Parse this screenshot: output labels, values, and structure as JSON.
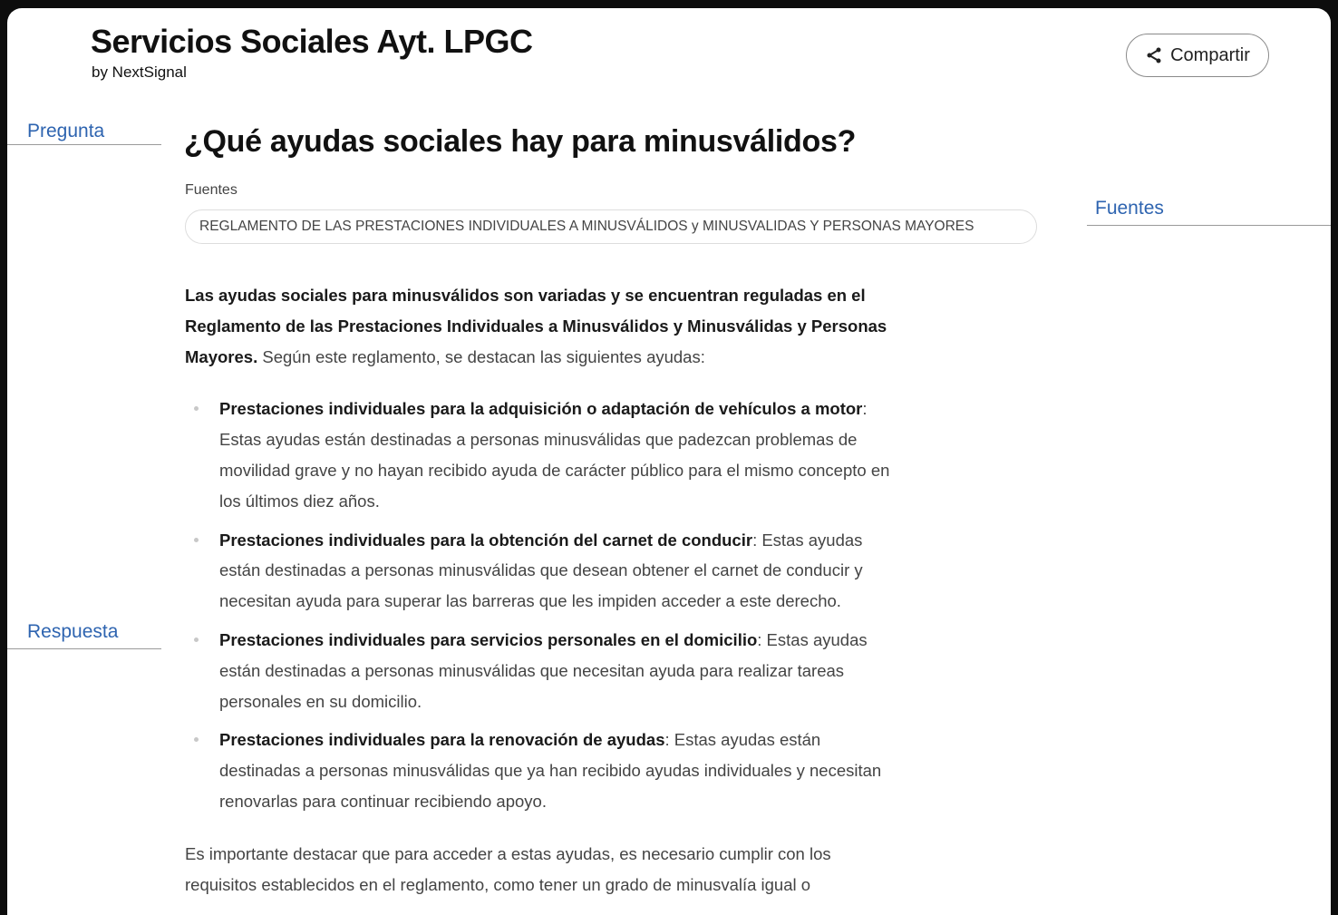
{
  "header": {
    "title": "Servicios Sociales Ayt. LPGC",
    "subtitle": "by NextSignal",
    "share_label": "Compartir"
  },
  "annotations": {
    "pregunta": "Pregunta",
    "fuentes": "Fuentes",
    "respuesta": "Respuesta"
  },
  "question": "¿Qué ayudas sociales hay para minusválidos?",
  "sources": {
    "label": "Fuentes",
    "items": [
      "REGLAMENTO DE LAS PRESTACIONES INDIVIDUALES A MINUSVÁLIDOS y MINUSVALIDAS Y PERSONAS MAYORES"
    ]
  },
  "answer": {
    "intro_bold": "Las ayudas sociales para minusválidos son variadas y se encuentran reguladas en el Reglamento de las Prestaciones Individuales a Minusválidos y Minusválidas y Personas Mayores.",
    "intro_rest": " Según este reglamento, se destacan las siguientes ayudas:",
    "items": [
      {
        "title": "Prestaciones individuales para la adquisición o adaptación de vehículos a motor",
        "text": ": Estas ayudas están destinadas a personas minusválidas que padezcan problemas de movilidad grave y no hayan recibido ayuda de carácter público para el mismo concepto en los últimos diez años."
      },
      {
        "title": "Prestaciones individuales para la obtención del carnet de conducir",
        "text": ": Estas ayudas están destinadas a personas minusválidas que desean obtener el carnet de conducir y necesitan ayuda para superar las barreras que les impiden acceder a este derecho."
      },
      {
        "title": "Prestaciones individuales para servicios personales en el domicilio",
        "text": ": Estas ayudas están destinadas a personas minusválidas que necesitan ayuda para realizar tareas personales en su domicilio."
      },
      {
        "title": "Prestaciones individuales para la renovación de ayudas",
        "text": ": Estas ayudas están destinadas a personas minusválidas que ya han recibido ayudas individuales y necesitan renovarlas para continuar recibiendo apoyo."
      }
    ],
    "closing": "Es importante destacar que para acceder a estas ayudas, es necesario cumplir con los requisitos establecidos en el reglamento, como tener un grado de minusvalía igual o"
  }
}
